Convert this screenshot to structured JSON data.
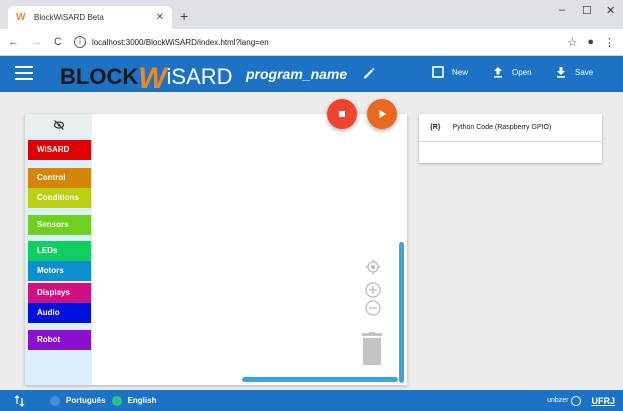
{
  "browser": {
    "tab_title": "BlockWiSARD Beta",
    "tab_favicon": "W",
    "new_tab": "+",
    "url": "localhost:3000/BlockWiSARD/index.html?lang=en",
    "window_controls": {
      "minimize": "–",
      "maximize": "☐",
      "close": "✕"
    }
  },
  "header": {
    "logo_part1": "BLOCK",
    "logo_w": "W",
    "logo_part2": "iSARD",
    "program_name": "program_name",
    "buttons": {
      "new": "New",
      "open": "Open",
      "save": "Save"
    }
  },
  "toolbox": {
    "categories": [
      {
        "label": "WiSARD",
        "color": "#e00000"
      },
      {
        "label": "Control",
        "color": "#d6850b"
      },
      {
        "label": "Conditions",
        "color": "#bad010"
      },
      {
        "label": "Sensors",
        "color": "#6fd020"
      },
      {
        "label": "LEDs",
        "color": "#0fcf60"
      },
      {
        "label": "Motors",
        "color": "#0a90d0"
      },
      {
        "label": "Displays",
        "color": "#d01080"
      },
      {
        "label": "Audio",
        "color": "#0010e0"
      },
      {
        "label": "Robot",
        "color": "#8a10d0"
      }
    ]
  },
  "code_panel": {
    "badge": "{R}",
    "title": "Python Code (Raspberry GPIO)"
  },
  "footer": {
    "lang_pt": "Português",
    "lang_en": "English",
    "partner1": "unbzer",
    "partner2": "UFRJ"
  },
  "colors": {
    "accent": "#1c72c4",
    "stop": "#f04433",
    "play": "#e96a1e",
    "scrollbar": "#3ea4de"
  }
}
